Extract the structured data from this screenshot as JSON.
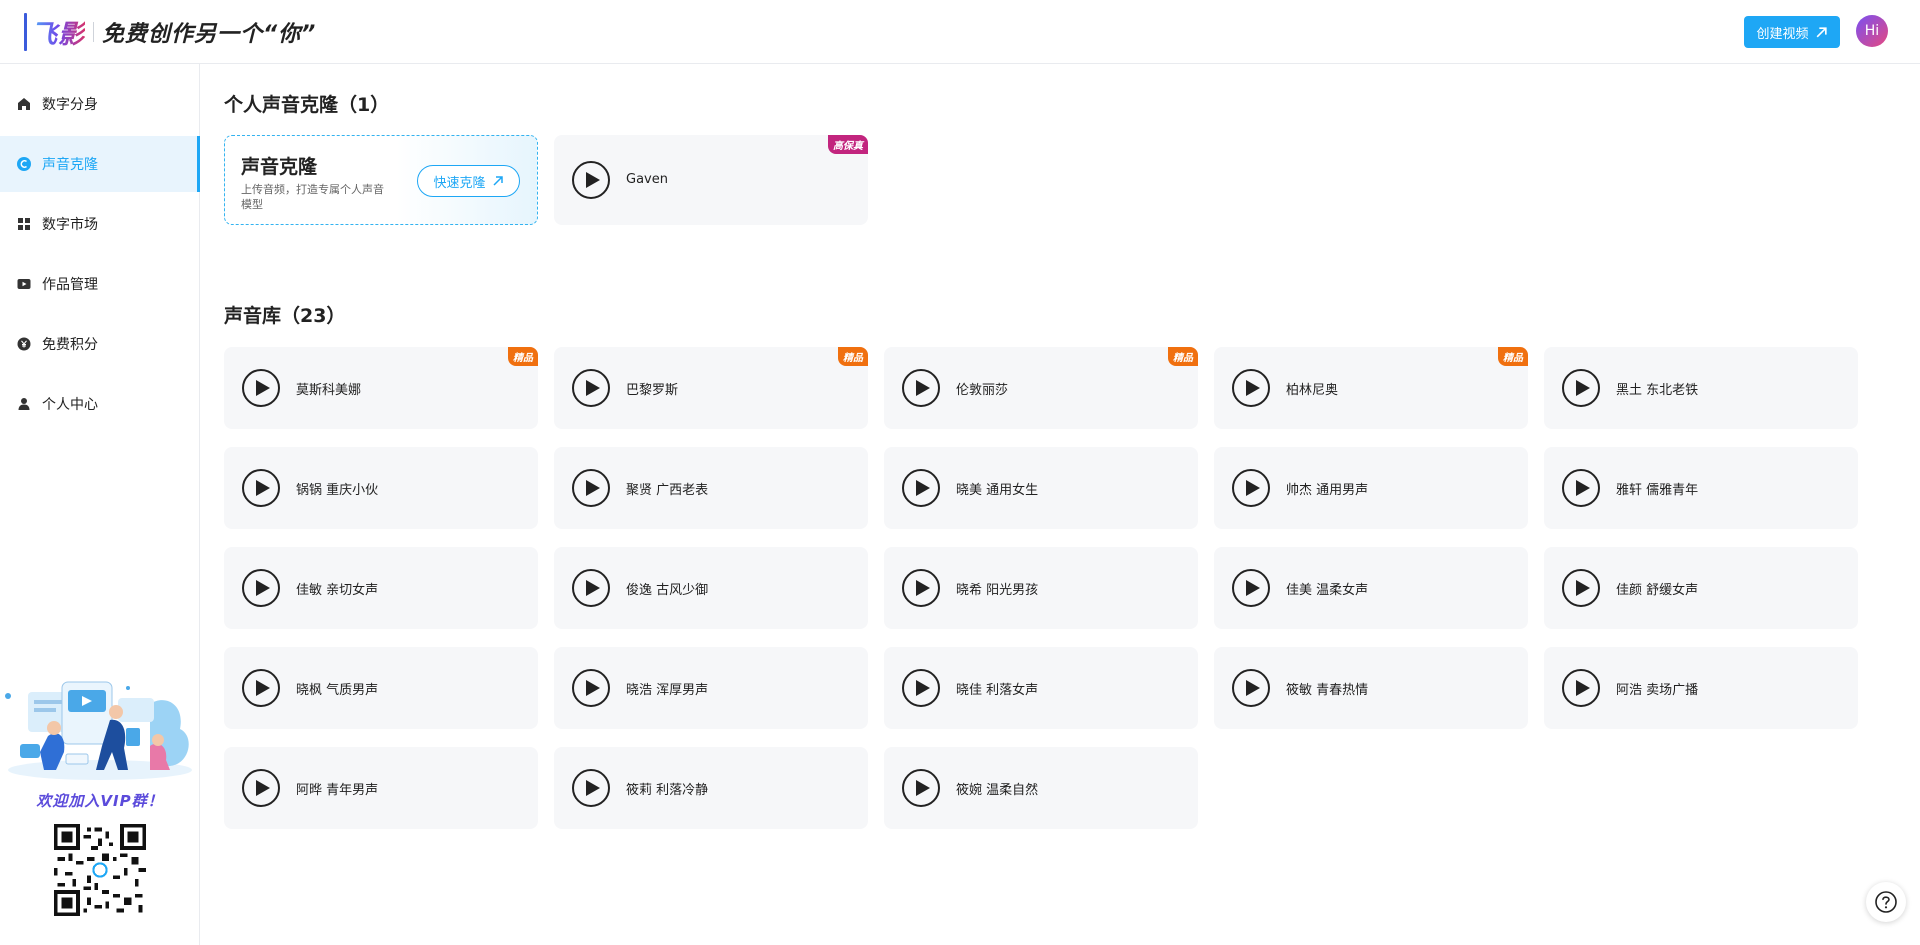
{
  "header": {
    "brand_logo": "飞影",
    "slogan": "免费创作另一个“你”",
    "create_video_label": "创建视频",
    "avatar_text": "Hi"
  },
  "sidebar": {
    "items": [
      {
        "label": "数字分身",
        "icon": "home-icon",
        "active": false
      },
      {
        "label": "声音克隆",
        "icon": "voice-clone-icon",
        "active": true
      },
      {
        "label": "数字市场",
        "icon": "grid-icon",
        "active": false
      },
      {
        "label": "作品管理",
        "icon": "video-icon",
        "active": false
      },
      {
        "label": "免费积分",
        "icon": "coin-icon",
        "active": false
      },
      {
        "label": "个人中心",
        "icon": "user-icon",
        "active": false
      }
    ],
    "promo_text": "欢迎加入VIP群！"
  },
  "personal": {
    "title": "个人声音克隆（1）",
    "clone_card": {
      "title": "声音克隆",
      "description": "上传音频，打造专属个人声音模型",
      "quick_button_label": "快速克隆"
    },
    "voices": [
      {
        "name": "Gaven",
        "badge": "高保真"
      }
    ]
  },
  "library": {
    "title": "声音库（23）",
    "voices": [
      {
        "name": "莫斯科美娜",
        "badge": "精品"
      },
      {
        "name": "巴黎罗斯",
        "badge": "精品"
      },
      {
        "name": "伦敦丽莎",
        "badge": "精品"
      },
      {
        "name": "柏林尼奥",
        "badge": "精品"
      },
      {
        "name": "黑土 东北老铁",
        "badge": ""
      },
      {
        "name": "锅锅 重庆小伙",
        "badge": ""
      },
      {
        "name": "聚贤 广西老表",
        "badge": ""
      },
      {
        "name": "晓美 通用女生",
        "badge": ""
      },
      {
        "name": "帅杰 通用男声",
        "badge": ""
      },
      {
        "name": "雅轩 儒雅青年",
        "badge": ""
      },
      {
        "name": "佳敏 亲切女声",
        "badge": ""
      },
      {
        "name": "俊逸 古风少御",
        "badge": ""
      },
      {
        "name": "晓希 阳光男孩",
        "badge": ""
      },
      {
        "name": "佳美 温柔女声",
        "badge": ""
      },
      {
        "name": "佳颜 舒缓女声",
        "badge": ""
      },
      {
        "name": "晓枫 气质男声",
        "badge": ""
      },
      {
        "name": "晓浩 浑厚男声",
        "badge": ""
      },
      {
        "name": "晓佳 利落女声",
        "badge": ""
      },
      {
        "name": "筱敏 青春热情",
        "badge": ""
      },
      {
        "name": "阿浩 卖场广播",
        "badge": ""
      },
      {
        "name": "阿晔 青年男声",
        "badge": ""
      },
      {
        "name": "筱莉 利落冷静",
        "badge": ""
      },
      {
        "name": "筱婉 温柔自然",
        "badge": ""
      }
    ]
  },
  "colors": {
    "accent": "#1ea7f5",
    "badge_jingpin": "#f0700f",
    "badge_gaobaozhen": "#c2257e",
    "card_bg": "#f6f7f9"
  }
}
